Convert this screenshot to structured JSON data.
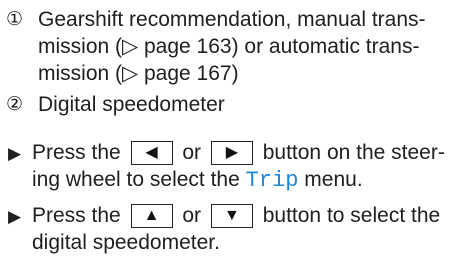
{
  "items": [
    {
      "marker": "①",
      "line1": "Gearshift recommendation, manual trans-",
      "line2": "mission (▷ page 163) or automatic trans-",
      "line3": "mission (▷ page 167)"
    },
    {
      "marker": "②",
      "line1": "Digital speedometer"
    }
  ],
  "steps": [
    {
      "bullet": "▶",
      "pre": "Press the",
      "key1": "◀",
      "mid": "or",
      "key2": "▶",
      "post": "button on the steer-",
      "line2_pre": "ing wheel to select the",
      "menu": "Trip",
      "line2_post": "menu."
    },
    {
      "bullet": "▶",
      "pre": "Press the",
      "key1": "▲",
      "mid": "or",
      "key2": "▼",
      "post": "button to select the",
      "line2": "digital speedometer."
    }
  ]
}
